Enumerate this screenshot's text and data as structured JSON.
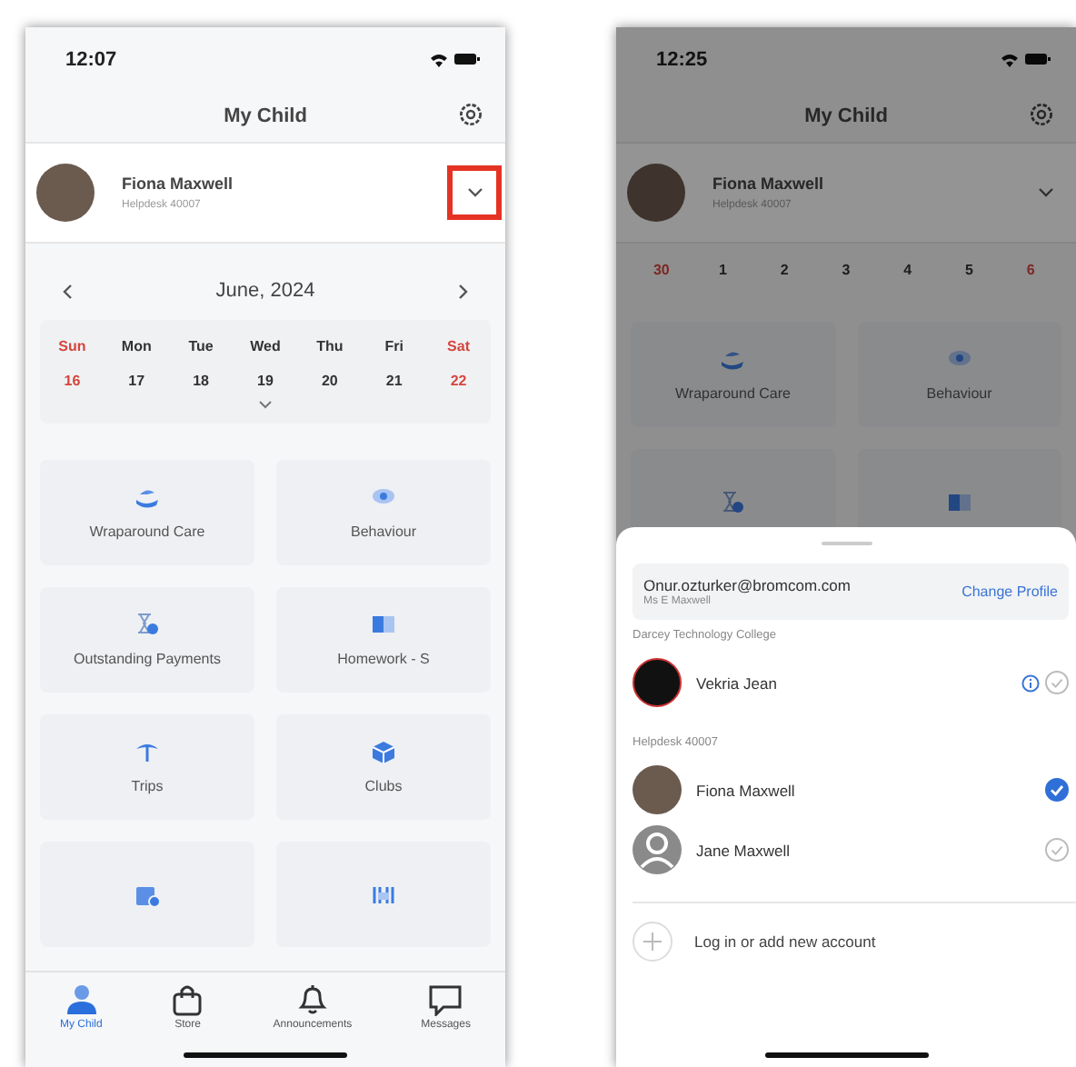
{
  "left_phone": {
    "status_bar": {
      "time": "12:07"
    },
    "header": {
      "title": "My Child"
    },
    "child": {
      "name": "Fiona Maxwell",
      "school": "Helpdesk 40007",
      "highlighted": true
    },
    "calendar": {
      "month": "June, 2024",
      "days": [
        {
          "label": "Sun",
          "weekend": true
        },
        {
          "label": "Mon",
          "weekend": false
        },
        {
          "label": "Tue",
          "weekend": false
        },
        {
          "label": "Wed",
          "weekend": false
        },
        {
          "label": "Thu",
          "weekend": false
        },
        {
          "label": "Fri",
          "weekend": false
        },
        {
          "label": "Sat",
          "weekend": true
        }
      ],
      "dates": [
        {
          "label": "16",
          "weekend": true
        },
        {
          "label": "17",
          "weekend": false
        },
        {
          "label": "18",
          "weekend": false
        },
        {
          "label": "19",
          "weekend": false
        },
        {
          "label": "20",
          "weekend": false
        },
        {
          "label": "21",
          "weekend": false
        },
        {
          "label": "22",
          "weekend": true
        }
      ]
    },
    "tiles": [
      {
        "kind": "labeled",
        "label": "Wraparound Care"
      },
      {
        "kind": "labeled",
        "label": "Behaviour"
      },
      {
        "kind": "labeled",
        "label": "Outstanding Payments"
      },
      {
        "kind": "labeled",
        "label": "Homework - S"
      },
      {
        "kind": "labeled",
        "label": "Trips"
      },
      {
        "kind": "labeled",
        "label": "Clubs"
      },
      {
        "kind": "icon_only"
      },
      {
        "kind": "icon_only"
      }
    ],
    "tabs": [
      {
        "label": "My Child",
        "selected": true
      },
      {
        "label": "Store",
        "selected": false
      },
      {
        "label": "Announcements",
        "selected": false
      },
      {
        "label": "Messages",
        "selected": false
      }
    ]
  },
  "right_phone": {
    "status_bar": {
      "time": "12:25"
    },
    "header": {
      "title": "My Child"
    },
    "child": {
      "name": "Fiona Maxwell",
      "school": "Helpdesk 40007",
      "highlighted": false
    },
    "calendar": {
      "dates": [
        {
          "label": "30",
          "weekend": true
        },
        {
          "label": "1",
          "weekend": false
        },
        {
          "label": "2",
          "weekend": false
        },
        {
          "label": "3",
          "weekend": false
        },
        {
          "label": "4",
          "weekend": false
        },
        {
          "label": "5",
          "weekend": false
        },
        {
          "label": "6",
          "weekend": true
        }
      ]
    },
    "tiles": [
      {
        "kind": "labeled",
        "label": "Wraparound Care"
      },
      {
        "kind": "labeled",
        "label": "Behaviour"
      },
      {
        "kind": "icon_only"
      },
      {
        "kind": "icon_only"
      }
    ],
    "sheet": {
      "account": {
        "email": "Onur.ozturker@bromcom.com",
        "name": "Ms E Maxwell",
        "action": "Change Profile"
      },
      "groups": [
        {
          "title": "Darcey Technology College",
          "children": [
            {
              "name": "Vekria Jean",
              "kind": "logo",
              "info": true,
              "selected": false
            }
          ]
        },
        {
          "title": "Helpdesk 40007",
          "children": [
            {
              "name": "Fiona Maxwell",
              "kind": "photo",
              "info": false,
              "selected": true
            },
            {
              "name": "Jane Maxwell",
              "kind": "silhouette",
              "info": false,
              "selected": false
            }
          ]
        }
      ],
      "add_account": "Log in or add new account"
    }
  }
}
